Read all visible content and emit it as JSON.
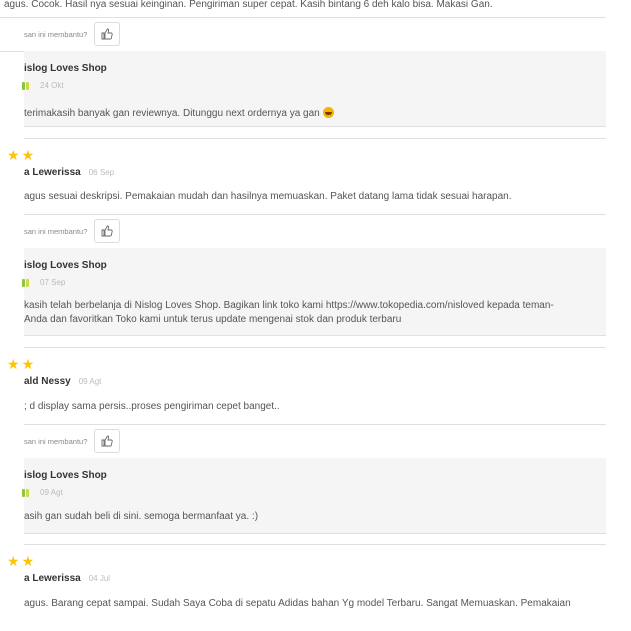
{
  "reviews": [
    {
      "id": "r1",
      "body": "agus. Cocok. Hasil nya sesuai keinginan. Pengiriman super cepat. Kasih bintang 6 deh kalo bisa. Makasi Gan.",
      "helpful_label": "san ini membantu?",
      "reply": {
        "shop": "islog Loves Shop",
        "date": "24 Okt",
        "text": "terimakasih banyak gan reviewnya. Ditunggu next ordernya ya gan",
        "has_emoji": true
      }
    },
    {
      "id": "r2",
      "stars": 2,
      "name": "a Lewerissa",
      "date": "06 Sep",
      "body": "agus sesuai deskripsi. Pemakaian mudah dan hasilnya memuaskan. Paket datang lama tidak sesuai harapan.",
      "helpful_label": "san ini membantu?",
      "reply": {
        "shop": "islog Loves Shop",
        "date": "07 Sep",
        "text_lines": [
          "kasih telah berbelanja di Nislog Loves Shop. Bagikan link toko kami https://www.tokopedia.com/nisloved kepada teman-",
          "Anda dan favoritkan Toko kami untuk terus update mengenai stok dan produk terbaru"
        ]
      }
    },
    {
      "id": "r3",
      "stars": 2,
      "name": "ald Nessy",
      "date": "09 Agt",
      "body": "; d display sama persis..proses pengiriman cepet banget..",
      "helpful_label": "san ini membantu?",
      "reply": {
        "shop": "islog Loves Shop",
        "date": "09 Agt",
        "text": "asih gan sudah beli di sini. semoga bermanfaat ya. :)"
      }
    },
    {
      "id": "r4",
      "stars": 2,
      "name": "a Lewerissa",
      "date": "04 Jul",
      "body": "agus. Barang cepat sampai.  Sudah Saya Coba di sepatu Adidas bahan Yg model Terbaru. Sangat Memuaskan. Pemakaian"
    }
  ],
  "colors": {
    "star": "#ffc400",
    "badge": [
      "#8bc34a",
      "#cddc39",
      "#ffeb3b"
    ]
  },
  "icons": {
    "helpful": "thumbs-up-icon",
    "star": "star-icon",
    "badge": "shop-badge-icon"
  }
}
